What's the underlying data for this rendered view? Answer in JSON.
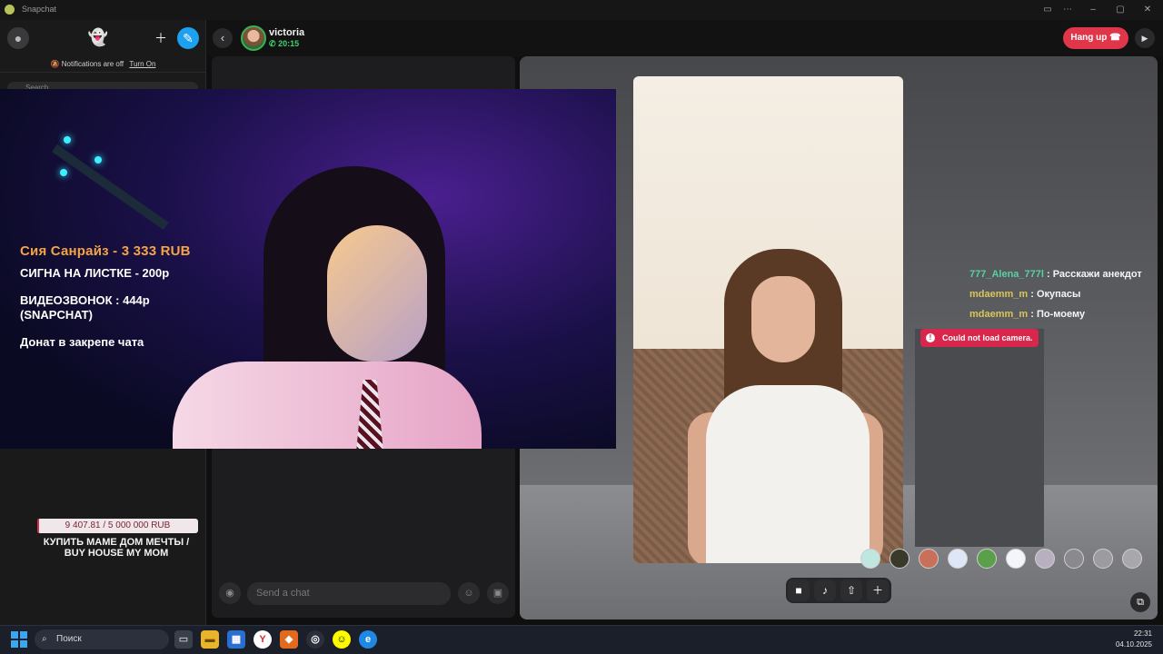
{
  "window": {
    "title": "Snapchat"
  },
  "sidebar": {
    "notifications_text": "Notifications are off",
    "turn_on_label": "Turn On",
    "search_placeholder": "Search"
  },
  "chat_header": {
    "contact_name": "victoria",
    "call_time": "20:15",
    "hangup_label": "Hang up"
  },
  "chat_panel": {
    "send_placeholder": "Send a chat"
  },
  "stream_overlay": {
    "sponsor_line": "Сия Санрайз - 3 333 RUB",
    "price_lines": [
      "СИГНА  НА ЛИСТКЕ - 200р",
      "ВИДЕОЗВОНОК  : 444р",
      "(SNAPCHAT)",
      "Донат в закрепе чата"
    ]
  },
  "donation_goal": {
    "progress_text": "9 407.81 / 5 000 000 RUB",
    "progress_fraction": 0.0019,
    "caption_line1": "КУПИТЬ МАМЕ ДОМ МЕЧТЫ /",
    "caption_line2": "BUY HOUSE MY MOM"
  },
  "chat_messages": [
    {
      "user": "777_Alena_777l",
      "text": ": Расскажи анекдот"
    },
    {
      "user": "mdaemm_m",
      "text": ": Окупасы"
    },
    {
      "user": "mdaemm_m",
      "text": ": По-моему"
    }
  ],
  "camera_error": "Could not load camera.",
  "lenses": [
    "lens-1",
    "lens-2",
    "lens-3",
    "lens-4",
    "lens-5",
    "lens-6",
    "lens-7",
    "lens-8",
    "lens-9",
    "lens-10"
  ],
  "taskbar": {
    "search_label": "Поиск",
    "time": "22:31",
    "date": "04.10.2025"
  },
  "colors": {
    "hangup": "#e0364a",
    "online": "#3ed36d",
    "error": "#d8264c",
    "overlay_orange": "#f5a444"
  }
}
